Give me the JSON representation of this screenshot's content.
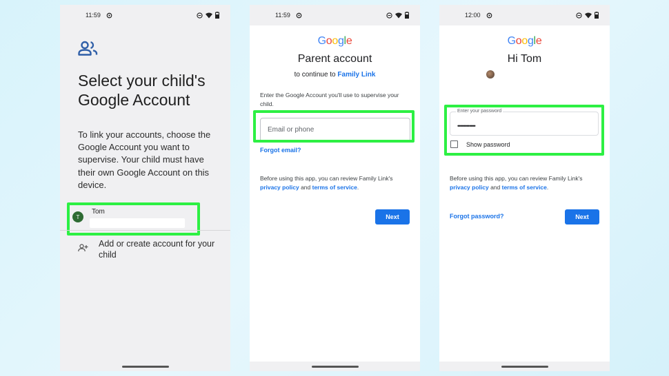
{
  "screen1": {
    "time": "11:59",
    "title": "Select your child's Google Account",
    "description": "To link your accounts, choose the Google Account you want to supervise. Your child must have their own Google Account on this device.",
    "account": {
      "initial": "T",
      "name": "Tom",
      "email": ""
    },
    "add_account_label": "Add or create account for your child"
  },
  "screen2": {
    "time": "11:59",
    "logo": {
      "g1": "G",
      "o1": "o",
      "o2": "o",
      "g2": "g",
      "l": "l",
      "e": "e"
    },
    "title": "Parent account",
    "subtitle_prefix": "to continue to ",
    "subtitle_link": "Family Link",
    "instructions": "Enter the Google Account you'll use to supervise your child.",
    "email_placeholder": "Email or phone",
    "forgot_email": "Forgot email?",
    "policy_prefix": "Before using this app, you can review Family Link's ",
    "privacy_policy": "privacy policy",
    "policy_and": " and ",
    "terms": "terms of service",
    "policy_end": ".",
    "next_label": "Next"
  },
  "screen3": {
    "time": "12:00",
    "logo": {
      "g1": "G",
      "o1": "o",
      "o2": "o",
      "g2": "g",
      "l": "l",
      "e": "e"
    },
    "title": "Hi Tom",
    "password_label": "Enter your password",
    "password_value": "••••••••••••",
    "show_password_label": "Show password",
    "policy_prefix": "Before using this app, you can review Family Link's ",
    "privacy_policy": "privacy policy",
    "policy_and": " and ",
    "terms": "terms of service",
    "policy_end": ".",
    "forgot_password": "Forgot password?",
    "next_label": "Next"
  },
  "colors": {
    "highlight": "#2df043",
    "google_blue": "#1a73e8",
    "avatar_green": "#2e6b33"
  }
}
